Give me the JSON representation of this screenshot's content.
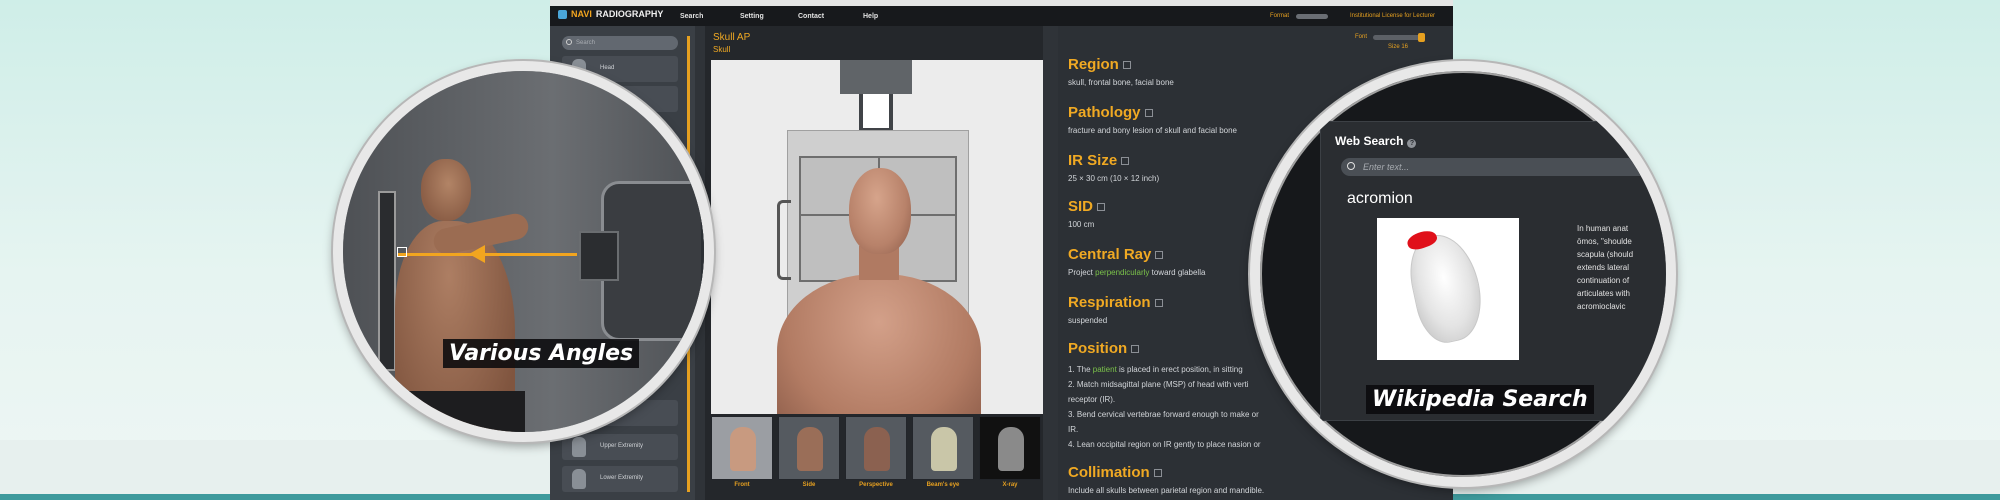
{
  "app": {
    "logo_navi": "NAVI",
    "logo_radiography": "RADIOGRAPHY",
    "menu": [
      "Search",
      "Setting",
      "Contact",
      "Help"
    ],
    "format_label": "Format",
    "license": "Institutional License for Lecturer"
  },
  "sidebar": {
    "search_placeholder": "Search",
    "items": [
      "Head",
      "Upper Extremity",
      "Lower Extremity"
    ]
  },
  "center": {
    "title": "Skull AP",
    "subtitle": "Skull",
    "thumbnails": [
      "Front",
      "Side",
      "Perspective",
      "Beam's eye",
      "X-ray"
    ]
  },
  "info": {
    "font_label": "Font",
    "font_size": "Size 16",
    "sections": {
      "region": {
        "title": "Region",
        "text": "skull, frontal bone, facial bone"
      },
      "pathology": {
        "title": "Pathology",
        "text": "fracture and bony lesion of skull and facial bone"
      },
      "irsize": {
        "title": "IR Size",
        "text": "25 × 30 cm (10 × 12 inch)"
      },
      "sid": {
        "title": "SID",
        "text": "100 cm"
      },
      "central_ray": {
        "title": "Central Ray",
        "text_a": "Project ",
        "text_highlight": "perpendicularly",
        "text_b": " toward glabella"
      },
      "respiration": {
        "title": "Respiration",
        "text": "suspended"
      },
      "position": {
        "title": "Position",
        "steps": [
          {
            "a": "1. The ",
            "hl": "patient",
            "b": " is placed in erect position, in sitting"
          },
          {
            "a": "2. Match midsagittal plane (MSP) of head with verti",
            "hl": "",
            "b": ""
          },
          {
            "a": "receptor (IR).",
            "hl": "",
            "b": ""
          },
          {
            "a": "3. Bend cervical vertebrae forward enough to make or",
            "hl": "",
            "b": ""
          },
          {
            "a": "IR.",
            "hl": "",
            "b": ""
          },
          {
            "a": "4. Lean occipital region on IR gently to place nasion or",
            "hl": "",
            "b": ""
          }
        ]
      },
      "collimation": {
        "title": "Collimation",
        "text": "Include all skulls between parietal region and mandible."
      }
    }
  },
  "callouts": {
    "left_caption": "Various Angles",
    "right_caption": "Wikipedia Search",
    "web_search_title": "Web Search",
    "web_search_help": "?",
    "web_search_placeholder": "Enter text...",
    "term": "acromion",
    "wiki_text": [
      "In human anat",
      "ōmos, \"shoulde",
      "scapula (should",
      "extends lateral",
      "continuation of",
      "articulates with",
      "acromioclavic"
    ]
  },
  "colors": {
    "accent": "#f0a923",
    "highlight": "#7bc24a",
    "acromion": "#e0101a"
  }
}
